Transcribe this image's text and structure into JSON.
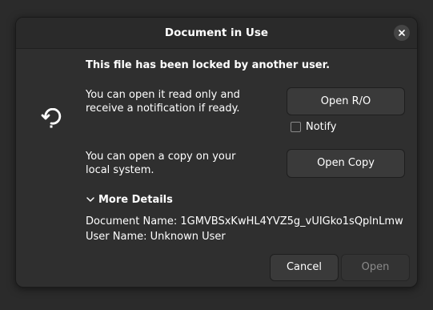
{
  "dialog": {
    "title": "Document in Use",
    "close_icon": "close-icon",
    "lock_icon": "locked-document-icon",
    "heading": "This file has been locked by another user.",
    "read_only_text": "You can open it read only  and\nreceive a notification if ready.",
    "open_ro_label": "Open R/O",
    "notify_label": "Notify",
    "notify_checked": false,
    "copy_text": "You can open a copy on your\nlocal system.",
    "open_copy_label": "Open Copy",
    "details_toggle_label": "More Details",
    "details_expanded": true,
    "document_name_line": "Document Name: 1GMVBSxKwHL4YVZ5g_vUIGko1sQplnLmw",
    "user_name_line": "User Name: Unknown User",
    "cancel_label": "Cancel",
    "open_label": "Open",
    "open_enabled": false
  },
  "colors": {
    "background": "#2f2f2f",
    "titlebar": "#2a2a2a",
    "button": "#3a3a3a",
    "text": "#ffffff",
    "disabled_text": "#8a8a8a"
  }
}
